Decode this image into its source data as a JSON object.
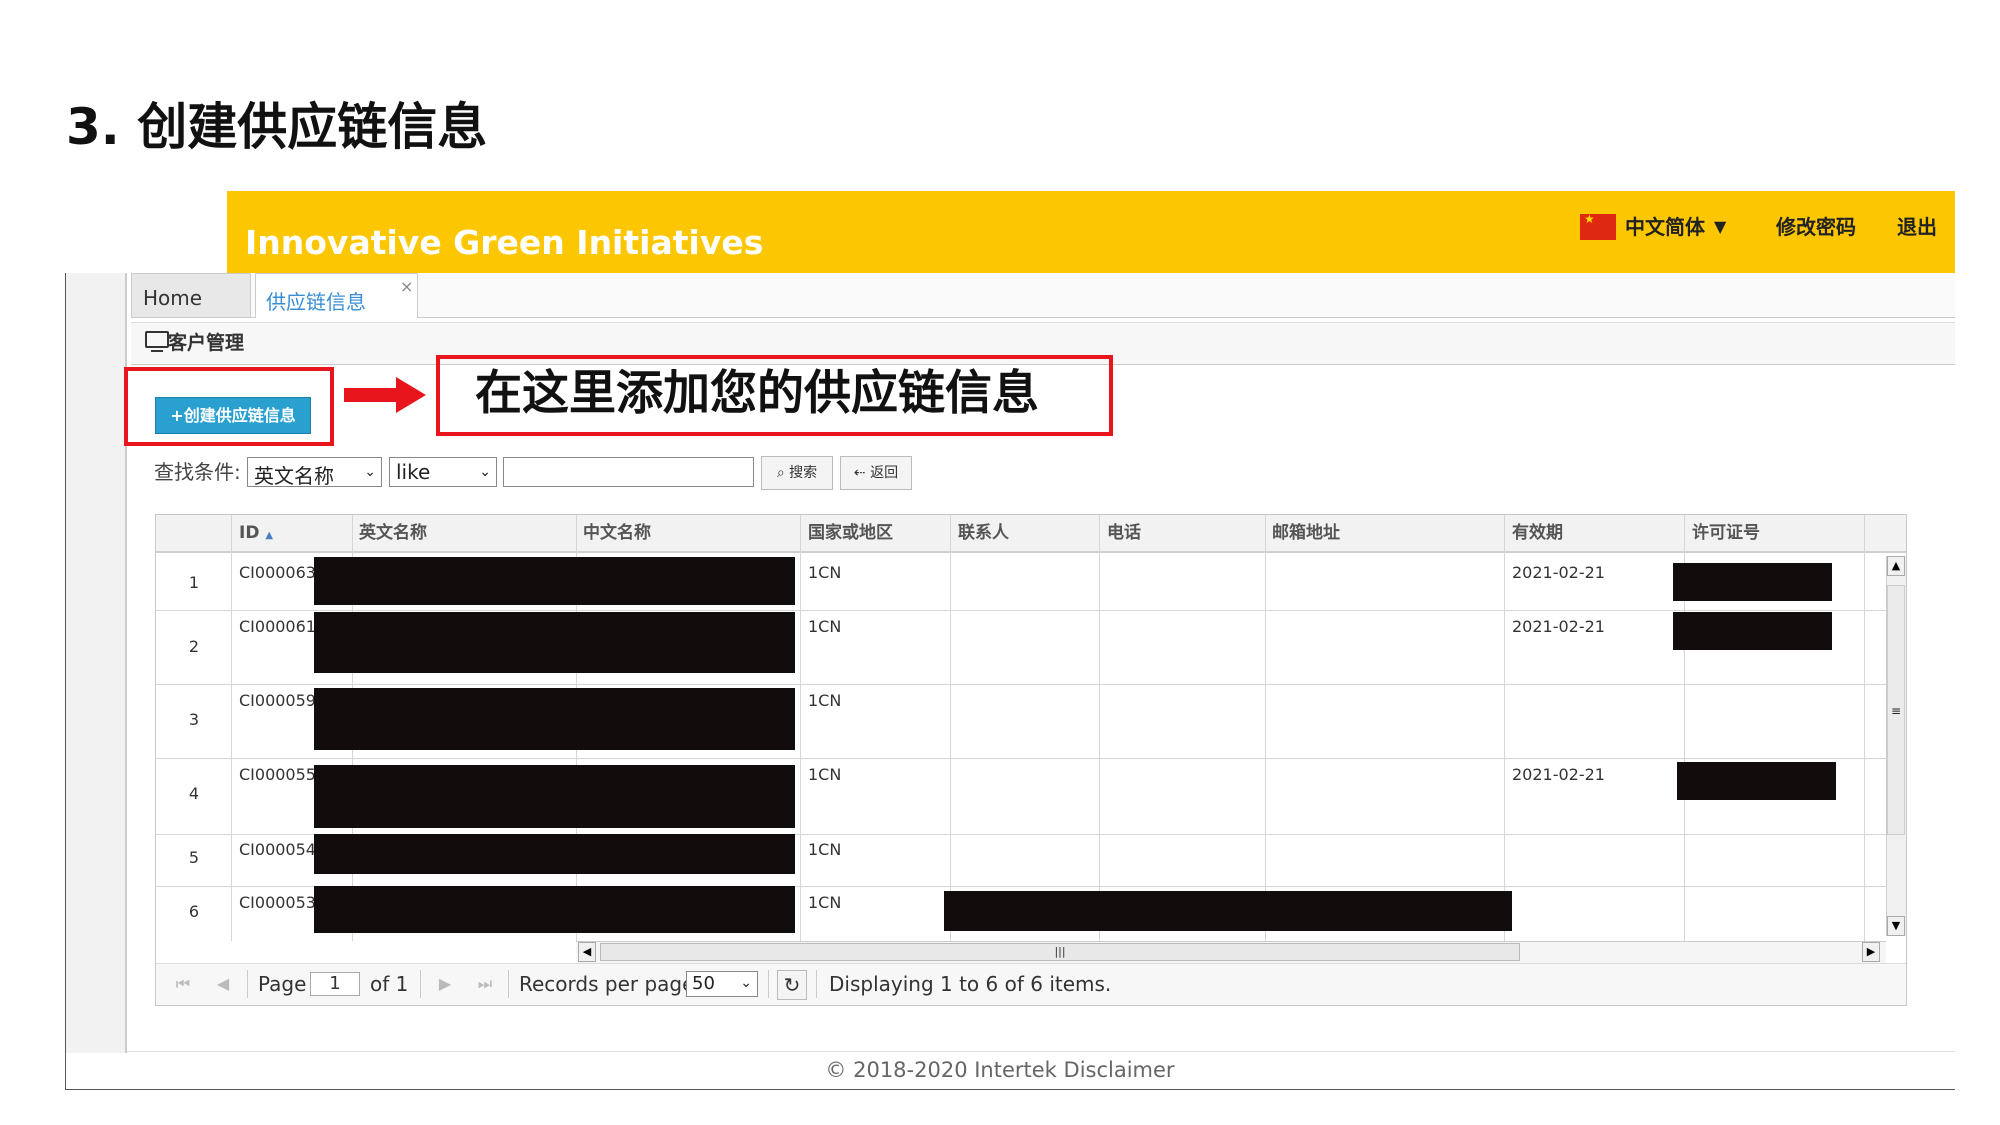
{
  "slide_title": "3. 创建供应链信息",
  "app": {
    "name": "Innovative Green Initiatives",
    "language": "中文简体",
    "change_password": "修改密码",
    "logout": "退出"
  },
  "tabs": [
    {
      "label": "Home",
      "active": false
    },
    {
      "label": "供应链信息",
      "active": true,
      "close": "×"
    }
  ],
  "panel_title": "客户管理",
  "create_button": "+创建供应链信息",
  "callout": "在这里添加您的供应链信息",
  "search": {
    "label": "查找条件:",
    "field": "英文名称",
    "operator": "like",
    "value": "",
    "search_button": "⌕ 搜索",
    "back_button": "⇠ 返回"
  },
  "grid": {
    "columns": [
      "ID",
      "英文名称",
      "中文名称",
      "国家或地区",
      "联系人",
      "电话",
      "邮箱地址",
      "有效期",
      "许可证号"
    ],
    "sort_indicator": "▲",
    "rows": [
      {
        "n": "1",
        "id": "CI000063",
        "country": "1CN",
        "valid": "2021-02-21"
      },
      {
        "n": "2",
        "id": "CI000061",
        "country": "1CN",
        "valid": "2021-02-21"
      },
      {
        "n": "3",
        "id": "CI000059",
        "country": "1CN",
        "valid": ""
      },
      {
        "n": "4",
        "id": "CI000055",
        "country": "1CN",
        "valid": "2021-02-21"
      },
      {
        "n": "5",
        "id": "CI000054",
        "country": "1CN",
        "valid": ""
      },
      {
        "n": "6",
        "id": "CI000053",
        "country": "1CN",
        "valid": ""
      }
    ]
  },
  "pagination": {
    "page_label": "Page",
    "page": "1",
    "of_label": "of 1",
    "records_label": "Records per page:",
    "per_page": "50",
    "summary": "Displaying 1 to 6 of 6 items."
  },
  "footer": "© 2018-2020 Intertek Disclaimer",
  "colors": {
    "topbar": "#fcc700",
    "button": "#2aa0d1",
    "annotation": "#e8161c",
    "redaction": "#120d0d"
  }
}
